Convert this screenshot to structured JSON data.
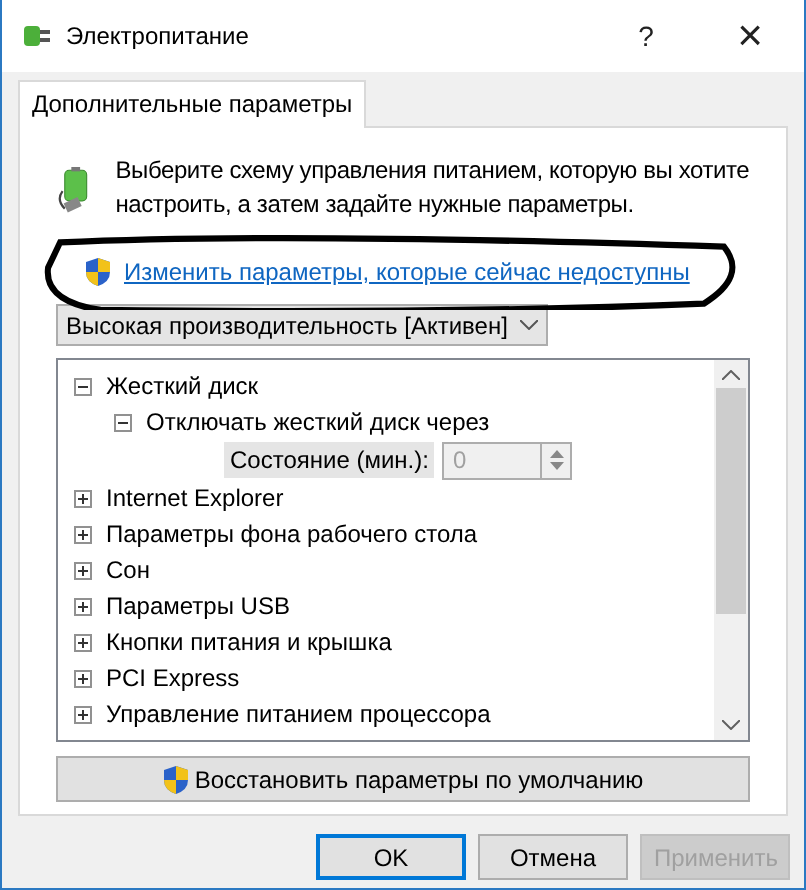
{
  "window": {
    "title": "Электропитание",
    "help": "?",
    "close": "×"
  },
  "tabs": [
    {
      "label": "Дополнительные параметры",
      "selected": true
    }
  ],
  "intro": "Выберите схему управления питанием, которую вы хотите настроить, а затем задайте нужные параметры.",
  "link": "Изменить параметры, которые сейчас недоступны",
  "annotation": {
    "kind": "ellipse"
  },
  "plan_dropdown": {
    "value": "Высокая производительность [Активен]"
  },
  "tree": [
    {
      "label": "Жесткий диск",
      "expanded": true,
      "children": [
        {
          "label": "Отключать жесткий диск через",
          "expanded": true,
          "setting": {
            "label": "Состояние (мин.):",
            "value": "0",
            "disabled": true
          }
        }
      ]
    },
    {
      "label": "Internet Explorer",
      "expanded": false
    },
    {
      "label": "Параметры фона рабочего стола",
      "expanded": false
    },
    {
      "label": "Сон",
      "expanded": false
    },
    {
      "label": "Параметры USB",
      "expanded": false
    },
    {
      "label": "Кнопки питания и крышка",
      "expanded": false
    },
    {
      "label": "PCI Express",
      "expanded": false
    },
    {
      "label": "Управление питанием процессора",
      "expanded": false
    }
  ],
  "restore_button": "Восстановить параметры по умолчанию",
  "buttons": [
    {
      "label": "OK",
      "default": true,
      "disabled": false
    },
    {
      "label": "Отмена",
      "default": false,
      "disabled": false
    },
    {
      "label": "Применить",
      "default": false,
      "disabled": true
    }
  ]
}
